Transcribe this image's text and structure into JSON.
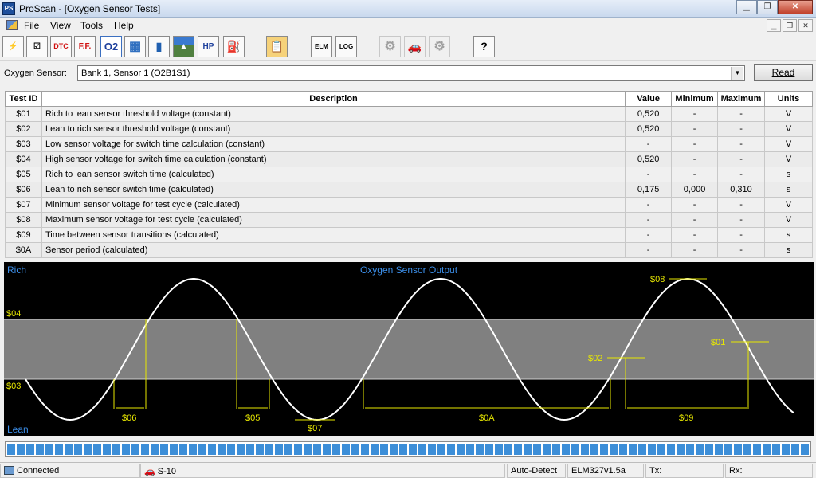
{
  "window": {
    "title": "ProScan - [Oxygen Sensor Tests]",
    "app_icon": "proscan-app-icon"
  },
  "menu": {
    "items": [
      "File",
      "View",
      "Tools",
      "Help"
    ]
  },
  "toolbar": {
    "buttons": [
      {
        "name": "connect-icon",
        "glyph": "⚡"
      },
      {
        "name": "checkmark-icon",
        "glyph": "☑"
      },
      {
        "name": "dtc-icon",
        "glyph": "DTC"
      },
      {
        "name": "freeze-frame-icon",
        "glyph": "F.F."
      },
      {
        "name": "o2-icon",
        "glyph": "O2"
      },
      {
        "name": "table-icon",
        "glyph": "▦"
      },
      {
        "name": "bar-graph-icon",
        "glyph": "▮"
      },
      {
        "name": "road-icon",
        "glyph": "▲"
      },
      {
        "name": "horsepower-icon",
        "glyph": "HP"
      },
      {
        "name": "fuel-icon",
        "glyph": "⛽"
      },
      {
        "name": "clipboard-icon",
        "glyph": "📋"
      },
      {
        "name": "elm-icon",
        "glyph": "ELM"
      },
      {
        "name": "log-icon",
        "glyph": "LOG"
      },
      {
        "name": "engine-icon",
        "glyph": "⚙"
      },
      {
        "name": "car-icon",
        "glyph": "🚗"
      },
      {
        "name": "gear-icon",
        "glyph": "⚙"
      },
      {
        "name": "help-icon",
        "glyph": "?"
      }
    ]
  },
  "sensor": {
    "label": "Oxygen Sensor:",
    "selected": "Bank 1, Sensor 1 (O2B1S1)",
    "read_label": "Read"
  },
  "table": {
    "headers": [
      "Test ID",
      "Description",
      "Value",
      "Minimum",
      "Maximum",
      "Units"
    ],
    "rows": [
      [
        "$01",
        "Rich to lean sensor threshold voltage (constant)",
        "0,520",
        "-",
        "-",
        "V"
      ],
      [
        "$02",
        "Lean to rich sensor threshold voltage (constant)",
        "0,520",
        "-",
        "-",
        "V"
      ],
      [
        "$03",
        "Low sensor voltage for switch time calculation (constant)",
        "-",
        "-",
        "-",
        "V"
      ],
      [
        "$04",
        "High sensor voltage for switch time calculation (constant)",
        "0,520",
        "-",
        "-",
        "V"
      ],
      [
        "$05",
        "Rich to lean sensor switch time (calculated)",
        "-",
        "-",
        "-",
        "s"
      ],
      [
        "$06",
        "Lean to rich sensor switch time (calculated)",
        "0,175",
        "0,000",
        "0,310",
        "s"
      ],
      [
        "$07",
        "Minimum sensor voltage for test cycle (calculated)",
        "-",
        "-",
        "-",
        "V"
      ],
      [
        "$08",
        "Maximum sensor voltage for test cycle (calculated)",
        "-",
        "-",
        "-",
        "V"
      ],
      [
        "$09",
        "Time between sensor transitions (calculated)",
        "-",
        "-",
        "-",
        "s"
      ],
      [
        "$0A",
        "Sensor period (calculated)",
        "-",
        "-",
        "-",
        "s"
      ]
    ]
  },
  "diagram": {
    "title": "Oxygen Sensor Output",
    "rich_label": "Rich",
    "lean_label": "Lean",
    "labels": {
      "s01": "$01",
      "s02": "$02",
      "s03": "$03",
      "s04": "$04",
      "s05": "$05",
      "s06": "$06",
      "s07": "$07",
      "s08": "$08",
      "s09": "$09",
      "s0a": "$0A"
    },
    "colors": {
      "background": "#000000",
      "band": "#808080",
      "wave": "#ffffff",
      "annotation": "#e8e800",
      "label_blue": "#3c8ee8"
    }
  },
  "progress": {
    "fill": 1.0,
    "color": "#3c8ed8"
  },
  "status": {
    "connection": "Connected",
    "vehicle": "S-10",
    "protocol": "Auto-Detect",
    "interface": "ELM327v1.5a",
    "tx": "Tx:",
    "rx": "Rx:"
  }
}
